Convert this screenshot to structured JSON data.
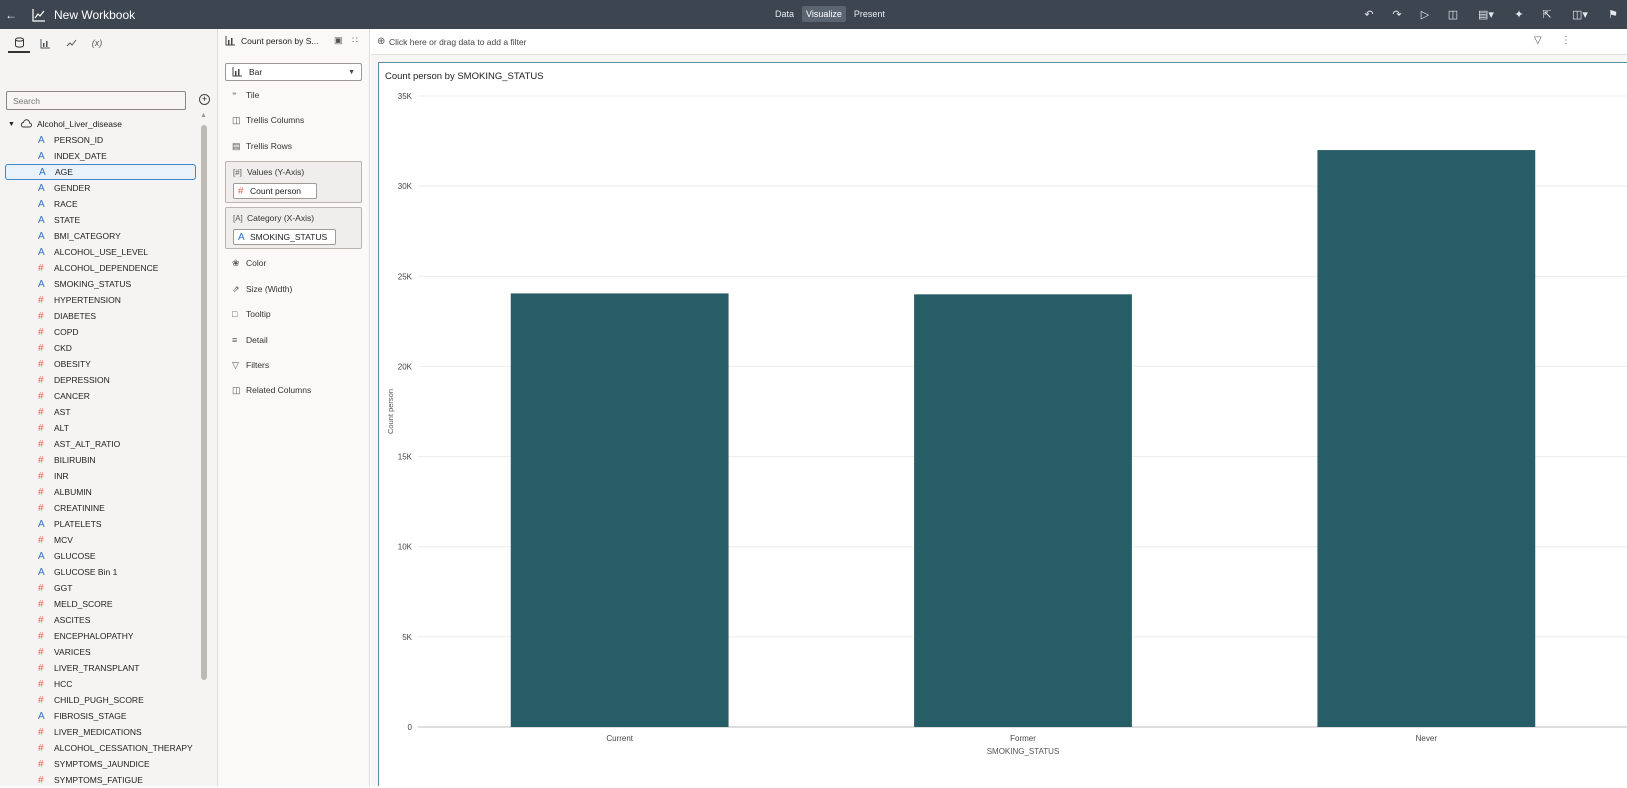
{
  "app": {
    "title": "New Workbook",
    "modes": [
      "Data",
      "Visualize",
      "Present"
    ],
    "active_mode": "Visualize"
  },
  "data_pane": {
    "search_placeholder": "Search",
    "dataset": "Alcohol_Liver_disease",
    "fields": [
      {
        "name": "PERSON_ID",
        "type": "attr"
      },
      {
        "name": "INDEX_DATE",
        "type": "attr"
      },
      {
        "name": "AGE",
        "type": "attr",
        "selected": true
      },
      {
        "name": "GENDER",
        "type": "attr"
      },
      {
        "name": "RACE",
        "type": "attr"
      },
      {
        "name": "STATE",
        "type": "attr"
      },
      {
        "name": "BMI_CATEGORY",
        "type": "attr"
      },
      {
        "name": "ALCOHOL_USE_LEVEL",
        "type": "attr"
      },
      {
        "name": "ALCOHOL_DEPENDENCE",
        "type": "num"
      },
      {
        "name": "SMOKING_STATUS",
        "type": "attr"
      },
      {
        "name": "HYPERTENSION",
        "type": "num"
      },
      {
        "name": "DIABETES",
        "type": "num"
      },
      {
        "name": "COPD",
        "type": "num"
      },
      {
        "name": "CKD",
        "type": "num"
      },
      {
        "name": "OBESITY",
        "type": "num"
      },
      {
        "name": "DEPRESSION",
        "type": "num"
      },
      {
        "name": "CANCER",
        "type": "num"
      },
      {
        "name": "AST",
        "type": "num"
      },
      {
        "name": "ALT",
        "type": "num"
      },
      {
        "name": "AST_ALT_RATIO",
        "type": "num"
      },
      {
        "name": "BILIRUBIN",
        "type": "num"
      },
      {
        "name": "INR",
        "type": "num"
      },
      {
        "name": "ALBUMIN",
        "type": "num"
      },
      {
        "name": "CREATININE",
        "type": "num"
      },
      {
        "name": "PLATELETS",
        "type": "attr"
      },
      {
        "name": "MCV",
        "type": "num"
      },
      {
        "name": "GLUCOSE",
        "type": "attr"
      },
      {
        "name": "GLUCOSE Bin 1",
        "type": "attr"
      },
      {
        "name": "GGT",
        "type": "num"
      },
      {
        "name": "MELD_SCORE",
        "type": "num"
      },
      {
        "name": "ASCITES",
        "type": "num"
      },
      {
        "name": "ENCEPHALOPATHY",
        "type": "num"
      },
      {
        "name": "VARICES",
        "type": "num"
      },
      {
        "name": "LIVER_TRANSPLANT",
        "type": "num"
      },
      {
        "name": "HCC",
        "type": "num"
      },
      {
        "name": "CHILD_PUGH_SCORE",
        "type": "num"
      },
      {
        "name": "FIBROSIS_STAGE",
        "type": "attr"
      },
      {
        "name": "LIVER_MEDICATIONS",
        "type": "num"
      },
      {
        "name": "ALCOHOL_CESSATION_THERAPY",
        "type": "num"
      },
      {
        "name": "SYMPTOMS_JAUNDICE",
        "type": "num"
      },
      {
        "name": "SYMPTOMS_FATIGUE",
        "type": "num"
      }
    ]
  },
  "grammar": {
    "viz_name": "Count person by S...",
    "viz_type": "Bar",
    "items_top": [
      "Tile",
      "Trellis Columns",
      "Trellis Rows"
    ],
    "values_label": "Values (Y-Axis)",
    "values_pill": "Count person",
    "category_label": "Category (X-Axis)",
    "category_pill": "SMOKING_STATUS",
    "items_bottom": [
      "Color",
      "Size (Width)",
      "Tooltip",
      "Detail",
      "Filters",
      "Related Columns"
    ]
  },
  "filter_bar": {
    "placeholder": "Click here or drag data to add a filter"
  },
  "colors": {
    "bar": "#275d66",
    "topbar": "#3c4550",
    "attr_icon": "#2f71c8",
    "measure_icon": "#e2664e"
  },
  "chart_data": {
    "type": "bar",
    "title": "Count person by SMOKING_STATUS",
    "xlabel": "SMOKING_STATUS",
    "ylabel": "Count person",
    "categories": [
      "Current",
      "Former",
      "Never"
    ],
    "values": [
      24050,
      24000,
      32000
    ],
    "ylim": [
      0,
      35000
    ],
    "yticks": [
      0,
      5000,
      10000,
      15000,
      20000,
      25000,
      30000,
      35000
    ],
    "ytick_labels": [
      "0",
      "5K",
      "10K",
      "15K",
      "20K",
      "25K",
      "30K",
      "35K"
    ],
    "grid": true,
    "legend": "none"
  }
}
